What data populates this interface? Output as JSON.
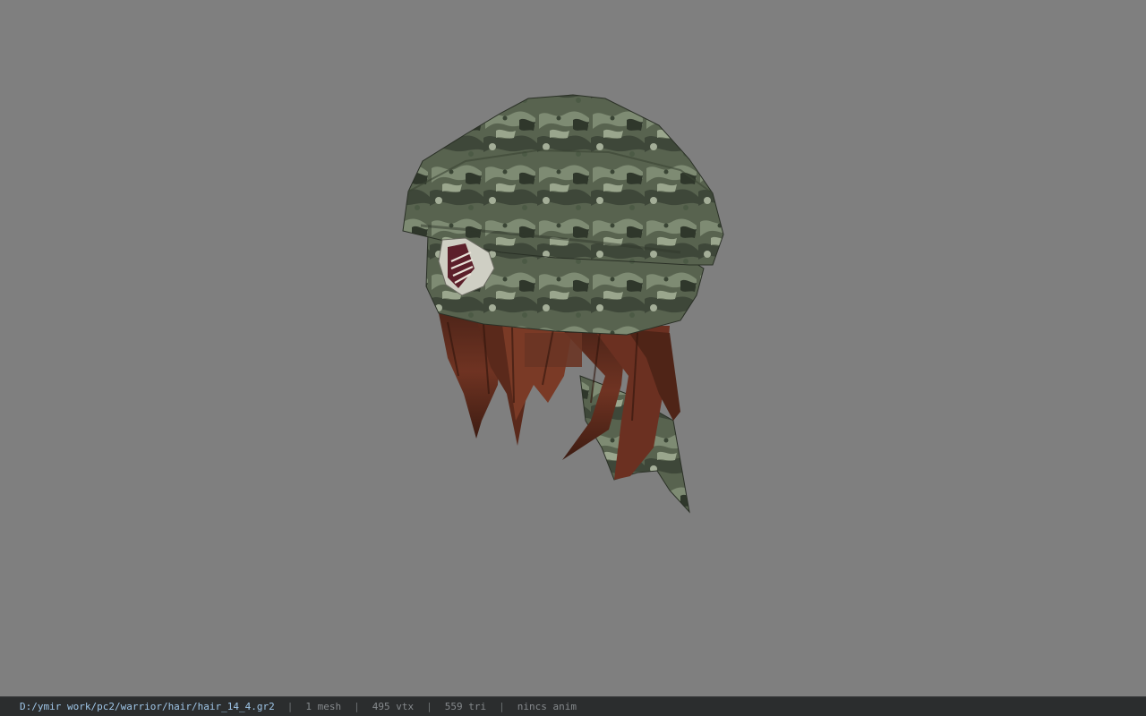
{
  "viewer": {
    "background_color": "#7f7f7f",
    "model_icon": "hair-helmet-model"
  },
  "statusbar": {
    "file_path": "D:/ymir work/pc2/warrior/hair/hair_14_4.gr2",
    "separator": "|",
    "mesh_count": "1 mesh",
    "vertex_count": "495 vtx",
    "triangle_count": "559 tri",
    "anim_status": "nincs anim"
  }
}
